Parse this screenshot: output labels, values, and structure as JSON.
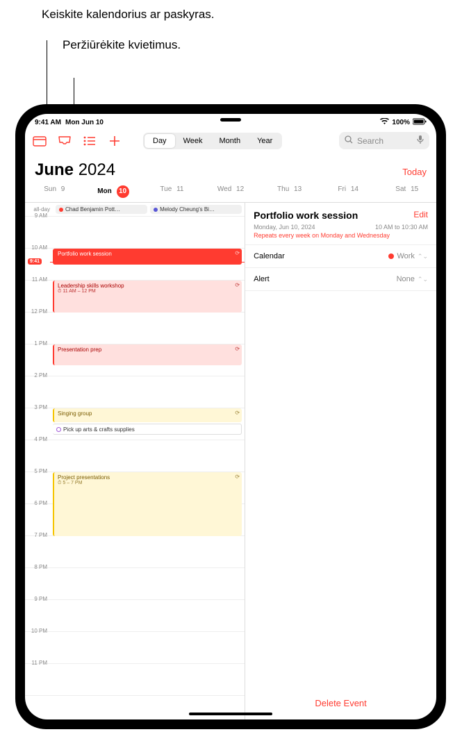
{
  "callouts": {
    "c1": "Keiskite kalendorius ar paskyras.",
    "c2": "Peržiūrėkite kvietimus."
  },
  "status": {
    "time": "9:41 AM",
    "date": "Mon Jun 10",
    "battery": "100%"
  },
  "toolbar": {
    "segments": {
      "day": "Day",
      "week": "Week",
      "month": "Month",
      "year": "Year"
    },
    "search_placeholder": "Search"
  },
  "header": {
    "month": "June",
    "year": "2024",
    "today": "Today"
  },
  "week": [
    {
      "label": "Sun",
      "num": "9"
    },
    {
      "label": "Mon",
      "num": "10"
    },
    {
      "label": "Tue",
      "num": "11"
    },
    {
      "label": "Wed",
      "num": "12"
    },
    {
      "label": "Thu",
      "num": "13"
    },
    {
      "label": "Fri",
      "num": "14"
    },
    {
      "label": "Sat",
      "num": "15"
    }
  ],
  "allday": {
    "label": "all-day",
    "items": [
      "Chad Benjamin Pott…",
      "Melody Cheung's Bi…"
    ]
  },
  "hours": [
    "9 AM",
    "10 AM",
    "11 AM",
    "12 PM",
    "1 PM",
    "2 PM",
    "3 PM",
    "4 PM",
    "5 PM",
    "6 PM",
    "7 PM",
    "8 PM",
    "9 PM",
    "10 PM",
    "11 PM"
  ],
  "now": "9:41",
  "events": {
    "e1": {
      "title": "Portfolio work session"
    },
    "e2": {
      "title": "Leadership skills workshop",
      "time": "11 AM – 12 PM"
    },
    "e3": {
      "title": "Presentation prep"
    },
    "e4": {
      "title": "Singing group"
    },
    "e5": {
      "title": "Pick up arts & crafts supplies"
    },
    "e6": {
      "title": "Project presentations",
      "time": "5 – 7 PM"
    }
  },
  "detail": {
    "title": "Portfolio work session",
    "edit": "Edit",
    "date": "Monday, Jun 10, 2024",
    "time": "10 AM to 10:30 AM",
    "repeat": "Repeats every week on Monday and Wednesday",
    "rows": {
      "calendar_label": "Calendar",
      "calendar_value": "Work",
      "alert_label": "Alert",
      "alert_value": "None"
    },
    "delete": "Delete Event"
  }
}
